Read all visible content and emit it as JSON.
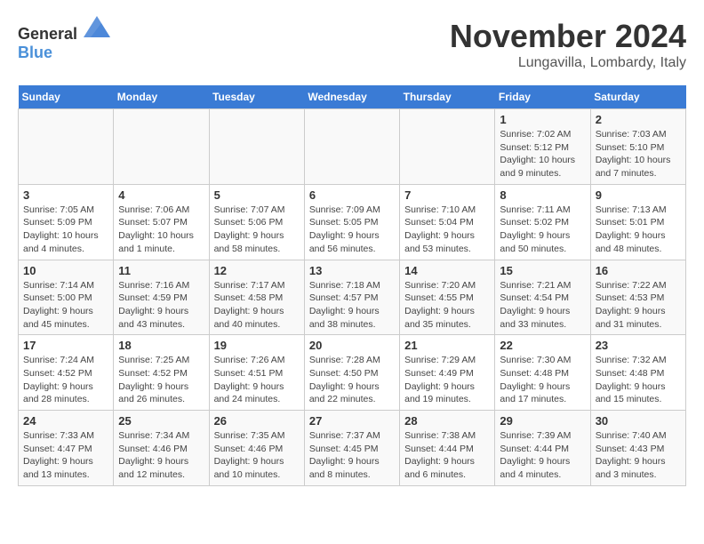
{
  "header": {
    "logo_general": "General",
    "logo_blue": "Blue",
    "month_title": "November 2024",
    "location": "Lungavilla, Lombardy, Italy"
  },
  "days_of_week": [
    "Sunday",
    "Monday",
    "Tuesday",
    "Wednesday",
    "Thursday",
    "Friday",
    "Saturday"
  ],
  "weeks": [
    [
      {
        "day": "",
        "info": ""
      },
      {
        "day": "",
        "info": ""
      },
      {
        "day": "",
        "info": ""
      },
      {
        "day": "",
        "info": ""
      },
      {
        "day": "",
        "info": ""
      },
      {
        "day": "1",
        "info": "Sunrise: 7:02 AM\nSunset: 5:12 PM\nDaylight: 10 hours and 9 minutes."
      },
      {
        "day": "2",
        "info": "Sunrise: 7:03 AM\nSunset: 5:10 PM\nDaylight: 10 hours and 7 minutes."
      }
    ],
    [
      {
        "day": "3",
        "info": "Sunrise: 7:05 AM\nSunset: 5:09 PM\nDaylight: 10 hours and 4 minutes."
      },
      {
        "day": "4",
        "info": "Sunrise: 7:06 AM\nSunset: 5:07 PM\nDaylight: 10 hours and 1 minute."
      },
      {
        "day": "5",
        "info": "Sunrise: 7:07 AM\nSunset: 5:06 PM\nDaylight: 9 hours and 58 minutes."
      },
      {
        "day": "6",
        "info": "Sunrise: 7:09 AM\nSunset: 5:05 PM\nDaylight: 9 hours and 56 minutes."
      },
      {
        "day": "7",
        "info": "Sunrise: 7:10 AM\nSunset: 5:04 PM\nDaylight: 9 hours and 53 minutes."
      },
      {
        "day": "8",
        "info": "Sunrise: 7:11 AM\nSunset: 5:02 PM\nDaylight: 9 hours and 50 minutes."
      },
      {
        "day": "9",
        "info": "Sunrise: 7:13 AM\nSunset: 5:01 PM\nDaylight: 9 hours and 48 minutes."
      }
    ],
    [
      {
        "day": "10",
        "info": "Sunrise: 7:14 AM\nSunset: 5:00 PM\nDaylight: 9 hours and 45 minutes."
      },
      {
        "day": "11",
        "info": "Sunrise: 7:16 AM\nSunset: 4:59 PM\nDaylight: 9 hours and 43 minutes."
      },
      {
        "day": "12",
        "info": "Sunrise: 7:17 AM\nSunset: 4:58 PM\nDaylight: 9 hours and 40 minutes."
      },
      {
        "day": "13",
        "info": "Sunrise: 7:18 AM\nSunset: 4:57 PM\nDaylight: 9 hours and 38 minutes."
      },
      {
        "day": "14",
        "info": "Sunrise: 7:20 AM\nSunset: 4:55 PM\nDaylight: 9 hours and 35 minutes."
      },
      {
        "day": "15",
        "info": "Sunrise: 7:21 AM\nSunset: 4:54 PM\nDaylight: 9 hours and 33 minutes."
      },
      {
        "day": "16",
        "info": "Sunrise: 7:22 AM\nSunset: 4:53 PM\nDaylight: 9 hours and 31 minutes."
      }
    ],
    [
      {
        "day": "17",
        "info": "Sunrise: 7:24 AM\nSunset: 4:52 PM\nDaylight: 9 hours and 28 minutes."
      },
      {
        "day": "18",
        "info": "Sunrise: 7:25 AM\nSunset: 4:52 PM\nDaylight: 9 hours and 26 minutes."
      },
      {
        "day": "19",
        "info": "Sunrise: 7:26 AM\nSunset: 4:51 PM\nDaylight: 9 hours and 24 minutes."
      },
      {
        "day": "20",
        "info": "Sunrise: 7:28 AM\nSunset: 4:50 PM\nDaylight: 9 hours and 22 minutes."
      },
      {
        "day": "21",
        "info": "Sunrise: 7:29 AM\nSunset: 4:49 PM\nDaylight: 9 hours and 19 minutes."
      },
      {
        "day": "22",
        "info": "Sunrise: 7:30 AM\nSunset: 4:48 PM\nDaylight: 9 hours and 17 minutes."
      },
      {
        "day": "23",
        "info": "Sunrise: 7:32 AM\nSunset: 4:48 PM\nDaylight: 9 hours and 15 minutes."
      }
    ],
    [
      {
        "day": "24",
        "info": "Sunrise: 7:33 AM\nSunset: 4:47 PM\nDaylight: 9 hours and 13 minutes."
      },
      {
        "day": "25",
        "info": "Sunrise: 7:34 AM\nSunset: 4:46 PM\nDaylight: 9 hours and 12 minutes."
      },
      {
        "day": "26",
        "info": "Sunrise: 7:35 AM\nSunset: 4:46 PM\nDaylight: 9 hours and 10 minutes."
      },
      {
        "day": "27",
        "info": "Sunrise: 7:37 AM\nSunset: 4:45 PM\nDaylight: 9 hours and 8 minutes."
      },
      {
        "day": "28",
        "info": "Sunrise: 7:38 AM\nSunset: 4:44 PM\nDaylight: 9 hours and 6 minutes."
      },
      {
        "day": "29",
        "info": "Sunrise: 7:39 AM\nSunset: 4:44 PM\nDaylight: 9 hours and 4 minutes."
      },
      {
        "day": "30",
        "info": "Sunrise: 7:40 AM\nSunset: 4:43 PM\nDaylight: 9 hours and 3 minutes."
      }
    ]
  ]
}
